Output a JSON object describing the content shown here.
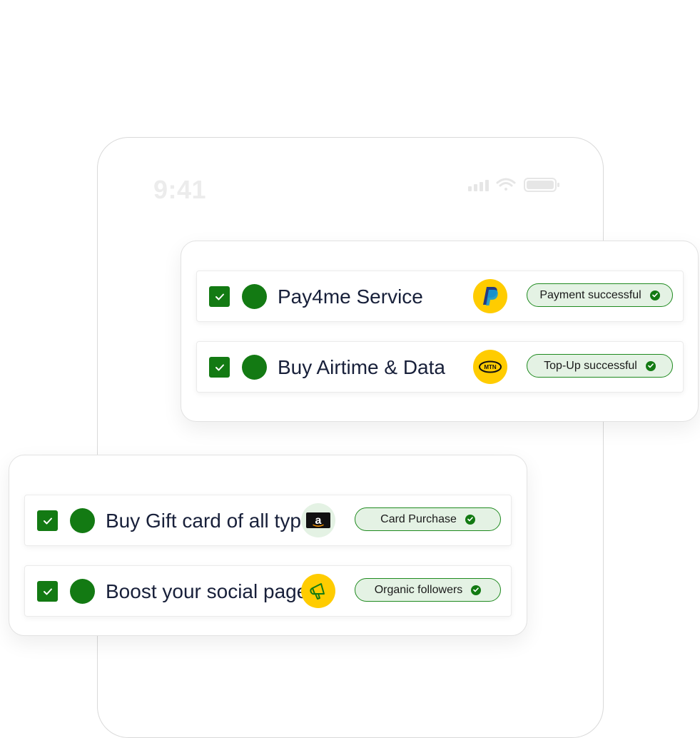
{
  "status_bar": {
    "time": "9:41"
  },
  "top_card": {
    "items": [
      {
        "label": "Pay4me Service",
        "logo": "paypal-icon",
        "status": "Payment successful"
      },
      {
        "label": "Buy Airtime & Data",
        "logo": "mtn-icon",
        "logo_text": "MTN",
        "status": "Top-Up successful"
      }
    ]
  },
  "bottom_card": {
    "items": [
      {
        "label": "Buy Gift card of all type",
        "logo": "amazon-gift-card-icon",
        "logo_text": "a",
        "status": "Card Purchase"
      },
      {
        "label": "Boost your social page",
        "logo": "megaphone-icon",
        "status": "Organic followers"
      }
    ]
  },
  "colors": {
    "accent_green": "#137a13",
    "pill_background": "#e4f2e4",
    "logo_yellow": "#ffcc00",
    "text_dark": "#18203a"
  }
}
